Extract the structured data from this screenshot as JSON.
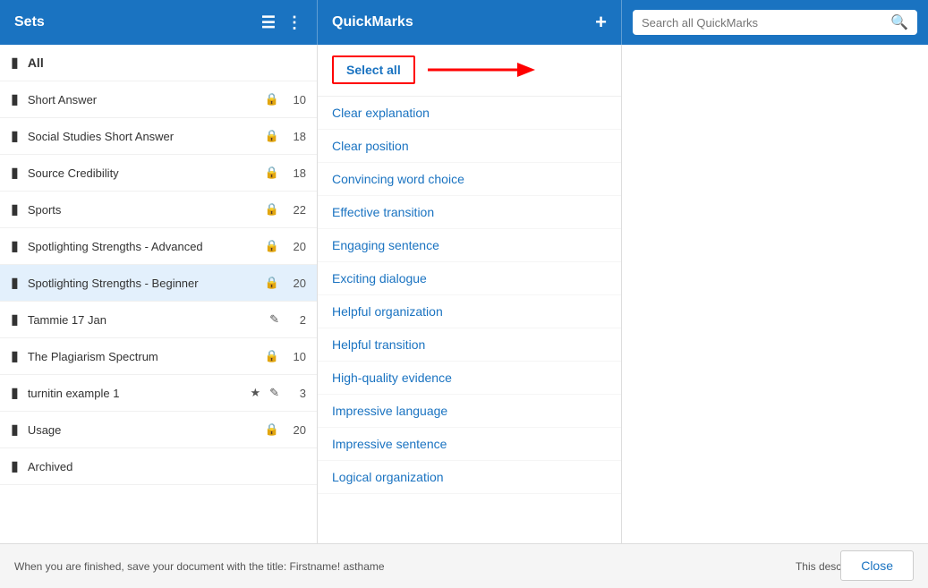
{
  "header": {
    "sets_label": "Sets",
    "quickmarks_label": "QuickMarks",
    "search_placeholder": "Search all QuickMarks"
  },
  "sets": {
    "items": [
      {
        "id": "all",
        "name": "All",
        "icon": "folder",
        "lock": false,
        "count": null,
        "selected": false,
        "all": true
      },
      {
        "id": "short-answer",
        "name": "Short Answer",
        "icon": "folder",
        "lock": true,
        "count": "10",
        "selected": false
      },
      {
        "id": "social-studies",
        "name": "Social Studies Short Answer",
        "icon": "folder",
        "lock": true,
        "count": "18",
        "selected": false
      },
      {
        "id": "source-credibility",
        "name": "Source Credibility",
        "icon": "folder",
        "lock": true,
        "count": "18",
        "selected": false
      },
      {
        "id": "sports",
        "name": "Sports",
        "icon": "folder",
        "lock": true,
        "count": "22",
        "selected": false
      },
      {
        "id": "spotlighting-advanced",
        "name": "Spotlighting Strengths - Advanced",
        "icon": "folder",
        "lock": true,
        "count": "20",
        "selected": false
      },
      {
        "id": "spotlighting-beginner",
        "name": "Spotlighting Strengths - Beginner",
        "icon": "folder",
        "lock": true,
        "count": "20",
        "selected": true
      },
      {
        "id": "tammie",
        "name": "Tammie 17 Jan",
        "icon": "folder",
        "lock": false,
        "count": "2",
        "edit": true,
        "selected": false
      },
      {
        "id": "plagiarism",
        "name": "The Plagiarism Spectrum",
        "icon": "folder",
        "lock": true,
        "count": "10",
        "selected": false
      },
      {
        "id": "turnitin",
        "name": "turnitin example 1",
        "icon": "folder",
        "lock": false,
        "count": "3",
        "star": true,
        "edit": true,
        "selected": false
      },
      {
        "id": "usage",
        "name": "Usage",
        "icon": "folder",
        "lock": true,
        "count": "20",
        "selected": false
      },
      {
        "id": "archived",
        "name": "Archived",
        "icon": "folder",
        "lock": false,
        "count": null,
        "selected": false
      }
    ]
  },
  "quickmarks": {
    "select_all_label": "Select all",
    "items": [
      {
        "id": "clear-explanation",
        "label": "Clear explanation"
      },
      {
        "id": "clear-position",
        "label": "Clear position"
      },
      {
        "id": "convincing-word-choice",
        "label": "Convincing word choice"
      },
      {
        "id": "effective-transition",
        "label": "Effective transition"
      },
      {
        "id": "engaging-sentence",
        "label": "Engaging sentence"
      },
      {
        "id": "exciting-dialogue",
        "label": "Exciting dialogue"
      },
      {
        "id": "helpful-organization",
        "label": "Helpful organization"
      },
      {
        "id": "helpful-transition",
        "label": "Helpful transition"
      },
      {
        "id": "high-quality-evidence",
        "label": "High-quality evidence"
      },
      {
        "id": "impressive-language",
        "label": "Impressive language"
      },
      {
        "id": "impressive-sentence",
        "label": "Impressive sentence"
      },
      {
        "id": "logical-organization",
        "label": "Logical organization"
      }
    ]
  },
  "footer": {
    "left_text": "When you are finished, save your document with the title: Firstname! asthame",
    "right_text": "This description is empty"
  },
  "close_button_label": "Close"
}
